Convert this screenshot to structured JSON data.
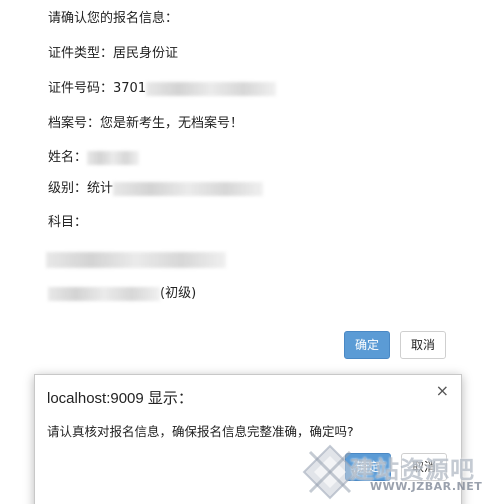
{
  "form": {
    "confirm_title": "请确认您的报名信息：",
    "id_type_label": "证件类型：",
    "id_type_value": "居民身份证",
    "id_number_label": "证件号码：",
    "id_number_value": "3701",
    "archive_label": "档案号：",
    "archive_value": "您是新考生，无档案号！",
    "name_label": "姓名：",
    "name_value": "",
    "level_label": "级别：",
    "level_value": "统计",
    "subject_label": "科目：",
    "item_suffix": "(初级)",
    "confirm_button": "确定",
    "cancel_button": "取消"
  },
  "dialog": {
    "title": "localhost:9009 显示：",
    "close_icon": "×",
    "message": "请认真核对报名信息，确保报名信息完整准确，确定吗?",
    "ok_button": "确定",
    "cancel_button": "取消"
  },
  "watermark": {
    "cn": "建站资源吧",
    "en": "WWW.JZBAR.NET"
  }
}
